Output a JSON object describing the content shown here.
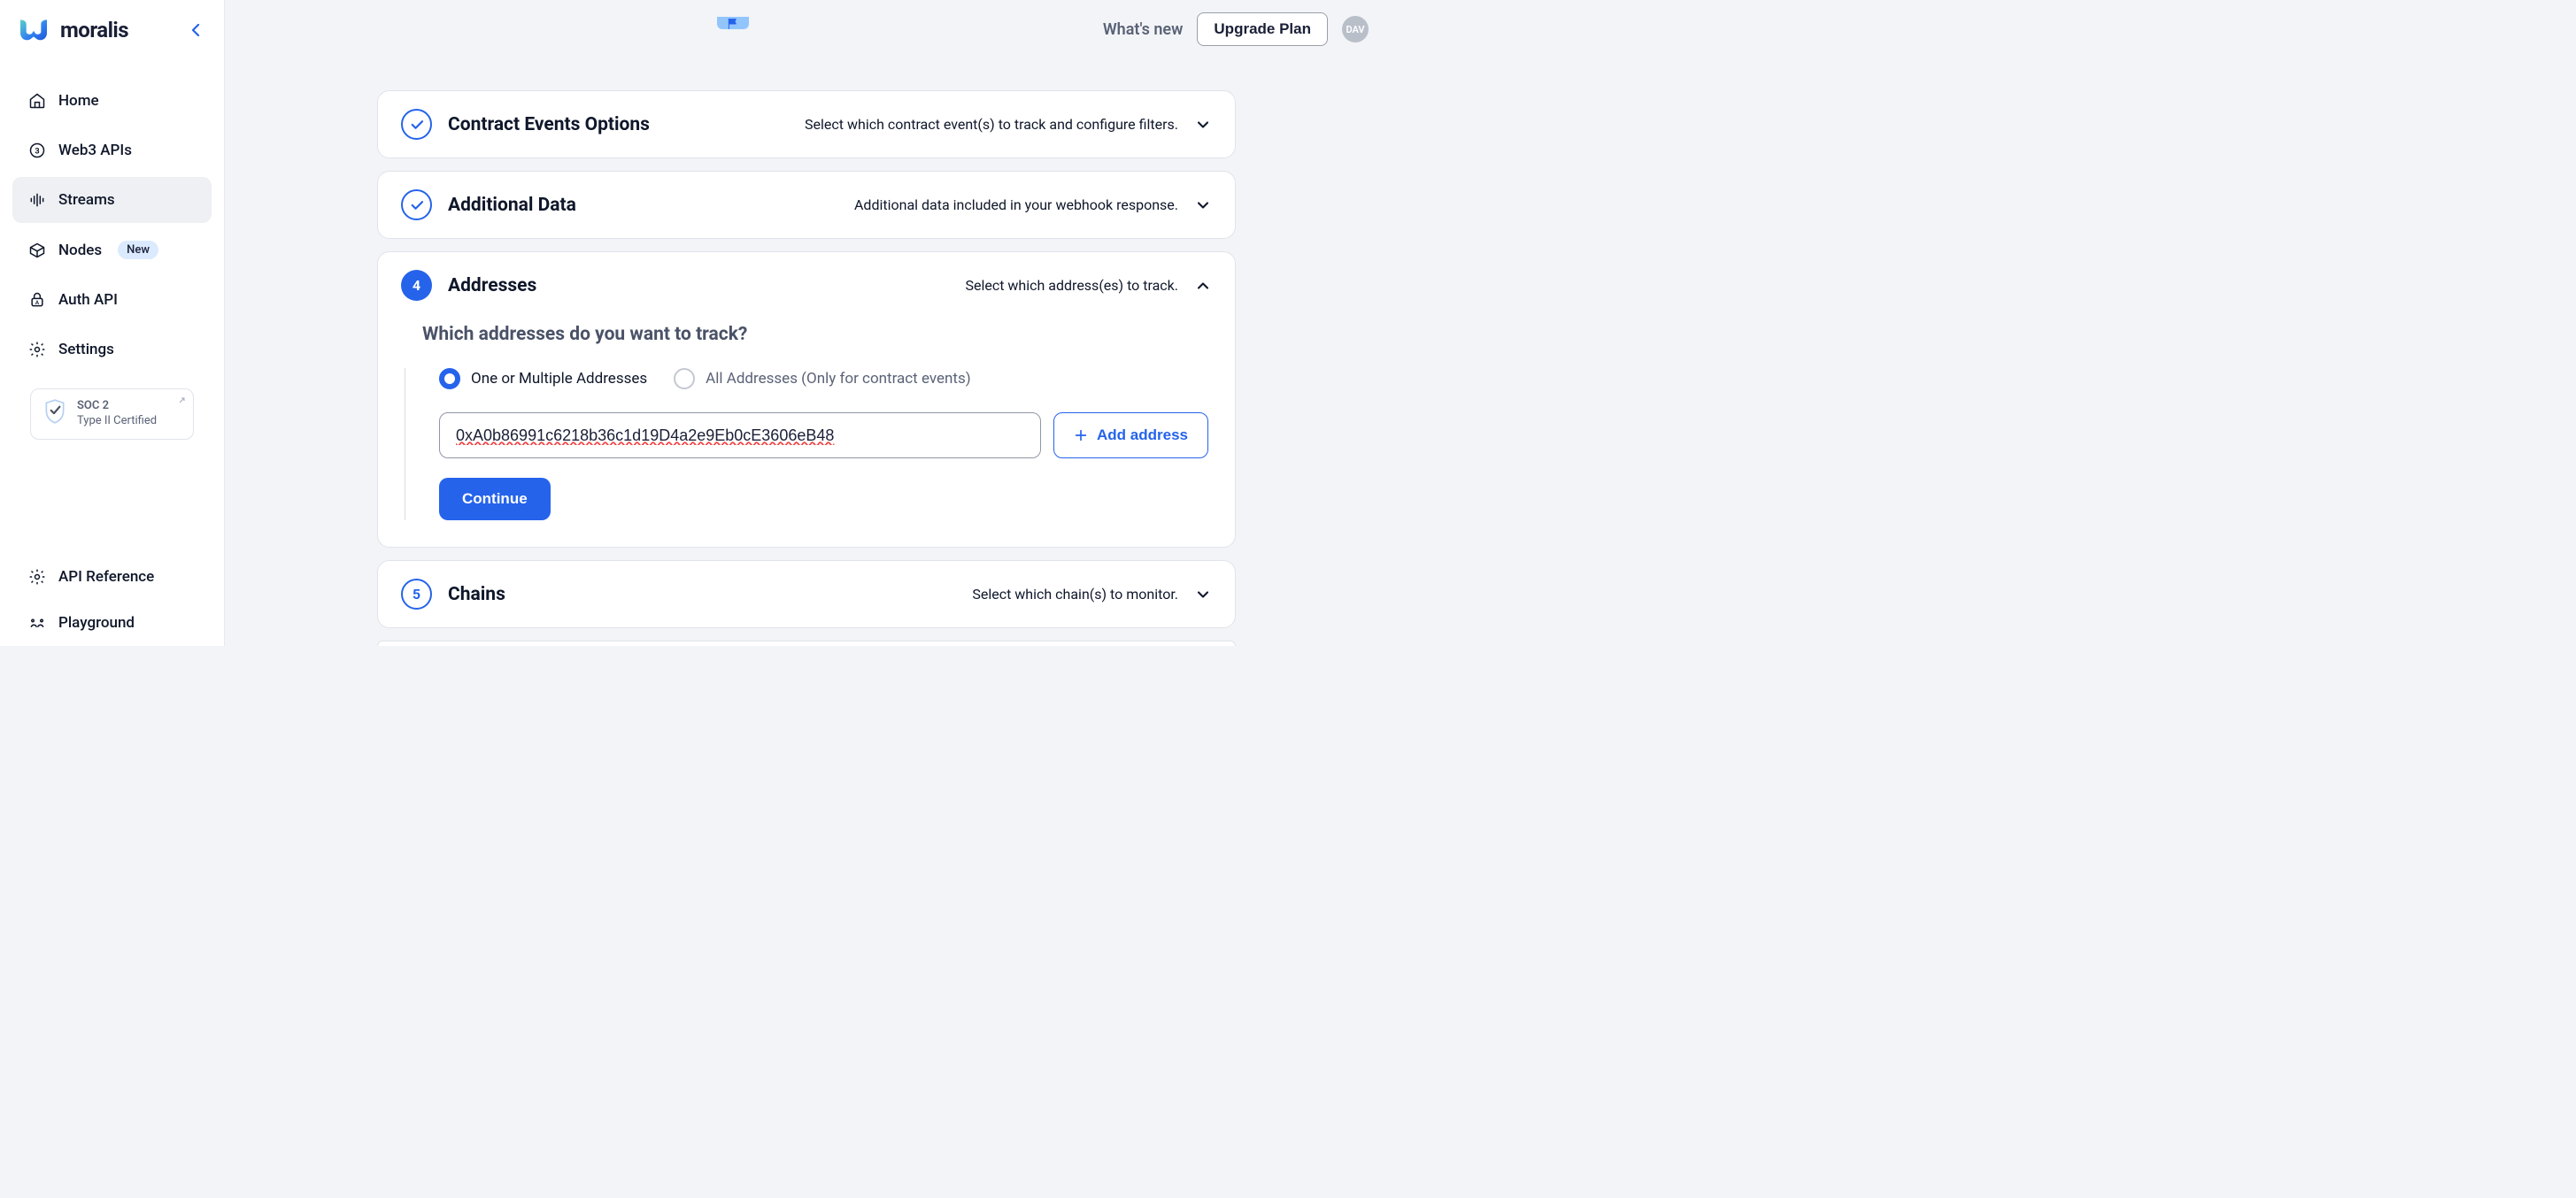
{
  "brand": {
    "name": "moralis"
  },
  "sidebar": {
    "items": [
      {
        "label": "Home"
      },
      {
        "label": "Web3 APIs"
      },
      {
        "label": "Streams"
      },
      {
        "label": "Nodes",
        "badge": "New"
      },
      {
        "label": "Auth API"
      },
      {
        "label": "Settings"
      }
    ],
    "cert": {
      "line1": "SOC 2",
      "line2": "Type II Certified"
    },
    "bottom": [
      {
        "label": "API Reference"
      },
      {
        "label": "Playground"
      }
    ]
  },
  "header": {
    "whats_new": "What's new",
    "upgrade": "Upgrade Plan",
    "avatar": "DAV"
  },
  "cards": {
    "contract": {
      "title": "Contract Events Options",
      "hint": "Select which contract event(s) to track and configure filters."
    },
    "additional": {
      "title": "Additional Data",
      "hint": "Additional data included in your webhook response."
    },
    "addresses": {
      "number": "4",
      "title": "Addresses",
      "hint": "Select which address(es) to track.",
      "prompt": "Which addresses do you want to track?",
      "radio1": "One or Multiple Addresses",
      "radio2": "All Addresses (Only for contract events)",
      "input_value": "0xA0b86991c6218b36c1d19D4a2e9Eb0cE3606eB48",
      "add_label": "Add address",
      "continue_label": "Continue"
    },
    "chains": {
      "number": "5",
      "title": "Chains",
      "hint": "Select which chain(s) to monitor."
    }
  }
}
